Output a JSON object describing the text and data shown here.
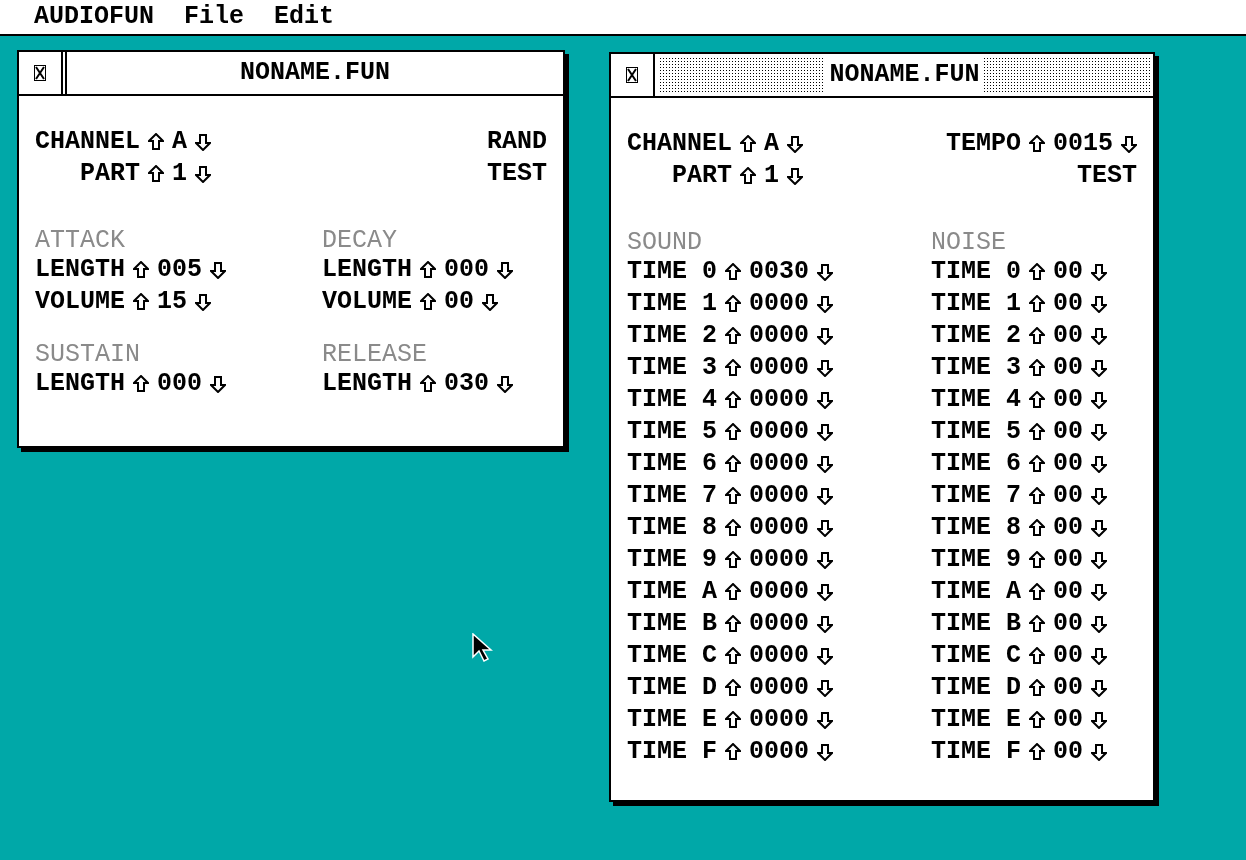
{
  "menu_bar": {
    "items": [
      "AUDIOFUN",
      "File",
      "Edit"
    ]
  },
  "windows": [
    {
      "title": "NONAME.FUN",
      "active": false,
      "left_controls": [
        {
          "label": "CHANNEL",
          "value": "A"
        },
        {
          "label": "PART",
          "value": "1"
        }
      ],
      "right_controls": [
        {
          "kind": "button",
          "label": "RAND"
        },
        {
          "kind": "button",
          "label": "TEST"
        }
      ],
      "sections": [
        {
          "heading": "ATTACK",
          "rows": [
            {
              "label": "LENGTH",
              "value": "005"
            },
            {
              "label": "VOLUME",
              "value": "15"
            }
          ]
        },
        {
          "heading": "DECAY",
          "rows": [
            {
              "label": "LENGTH",
              "value": "000"
            },
            {
              "label": "VOLUME",
              "value": "00"
            }
          ]
        },
        {
          "heading": "SUSTAIN",
          "rows": [
            {
              "label": "LENGTH",
              "value": "000"
            }
          ]
        },
        {
          "heading": "RELEASE",
          "rows": [
            {
              "label": "LENGTH",
              "value": "030"
            }
          ]
        }
      ]
    },
    {
      "title": "NONAME.FUN",
      "active": true,
      "left_controls": [
        {
          "label": "CHANNEL",
          "value": "A"
        },
        {
          "label": "PART",
          "value": "1"
        }
      ],
      "right_controls": [
        {
          "kind": "spinner",
          "label": "TEMPO",
          "value": "0015"
        },
        {
          "kind": "button",
          "label": "TEST"
        }
      ],
      "sections": [
        {
          "heading": "SOUND",
          "rows": [
            {
              "label": "TIME 0",
              "value": "0030"
            },
            {
              "label": "TIME 1",
              "value": "0000"
            },
            {
              "label": "TIME 2",
              "value": "0000"
            },
            {
              "label": "TIME 3",
              "value": "0000"
            },
            {
              "label": "TIME 4",
              "value": "0000"
            },
            {
              "label": "TIME 5",
              "value": "0000"
            },
            {
              "label": "TIME 6",
              "value": "0000"
            },
            {
              "label": "TIME 7",
              "value": "0000"
            },
            {
              "label": "TIME 8",
              "value": "0000"
            },
            {
              "label": "TIME 9",
              "value": "0000"
            },
            {
              "label": "TIME A",
              "value": "0000"
            },
            {
              "label": "TIME B",
              "value": "0000"
            },
            {
              "label": "TIME C",
              "value": "0000"
            },
            {
              "label": "TIME D",
              "value": "0000"
            },
            {
              "label": "TIME E",
              "value": "0000"
            },
            {
              "label": "TIME F",
              "value": "0000"
            }
          ]
        },
        {
          "heading": "NOISE",
          "rows": [
            {
              "label": "TIME 0",
              "value": "00"
            },
            {
              "label": "TIME 1",
              "value": "00"
            },
            {
              "label": "TIME 2",
              "value": "00"
            },
            {
              "label": "TIME 3",
              "value": "00"
            },
            {
              "label": "TIME 4",
              "value": "00"
            },
            {
              "label": "TIME 5",
              "value": "00"
            },
            {
              "label": "TIME 6",
              "value": "00"
            },
            {
              "label": "TIME 7",
              "value": "00"
            },
            {
              "label": "TIME 8",
              "value": "00"
            },
            {
              "label": "TIME 9",
              "value": "00"
            },
            {
              "label": "TIME A",
              "value": "00"
            },
            {
              "label": "TIME B",
              "value": "00"
            },
            {
              "label": "TIME C",
              "value": "00"
            },
            {
              "label": "TIME D",
              "value": "00"
            },
            {
              "label": "TIME E",
              "value": "00"
            },
            {
              "label": "TIME F",
              "value": "00"
            }
          ]
        }
      ]
    }
  ]
}
